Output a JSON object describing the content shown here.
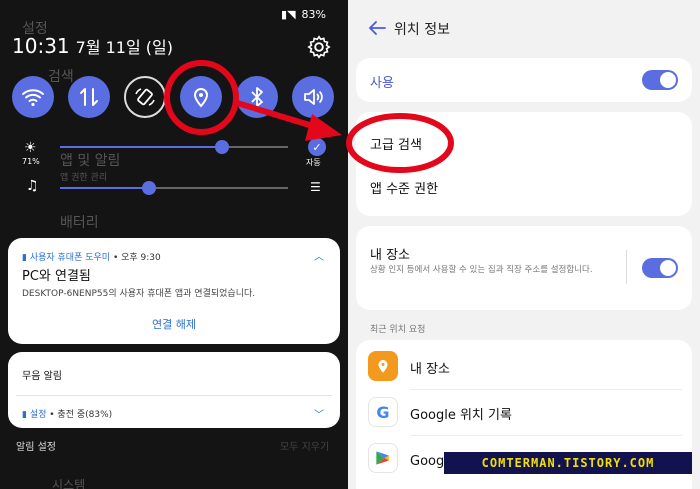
{
  "left_panel": {
    "statusbar": {
      "battery": "83%"
    },
    "ghost": {
      "settings": "설정",
      "search": "검색",
      "app_alarm": "앱 및 알림",
      "app_alarm_sub": "앱 권한 관리",
      "battery": "배터리",
      "system": "시스템"
    },
    "clock": {
      "time": "10:31",
      "date": "7월 11일 (일)"
    },
    "quick_settings": [
      "wifi",
      "mobile-data",
      "auto-rotate",
      "location",
      "bluetooth",
      "sound"
    ],
    "brightness": {
      "value_label": "71%",
      "auto_label": "자동",
      "level": 0.71
    },
    "volume": {
      "level": 0.39
    },
    "notification": {
      "app": "사용자 휴대폰 도우미",
      "time": " • 오후 9:30",
      "title": "PC와 연결됨",
      "body": "DESKTOP-6NENP55의 사용자 휴대폰 앱과 연결되었습니다.",
      "action": "연결 해제"
    },
    "silent": {
      "header": "무음 알림",
      "app": "설정",
      "text": " • 충전 중(83%)"
    },
    "footer": {
      "settings": "알림 설정",
      "clear": "모두 지우기"
    }
  },
  "right_panel": {
    "header": {
      "title": "위치 정보"
    },
    "use": {
      "label": "사용",
      "enabled": true
    },
    "menu": {
      "advanced": "고급 검색",
      "app_perm": "앱 수준 권한"
    },
    "my_place": {
      "title": "내 장소",
      "subtitle": "상황 인지 등에서 사용할 수 있는 집과 직장 주소를 설정합니다.",
      "enabled": true
    },
    "recent_label": "최근 위치 요청",
    "recent": [
      {
        "label": "내 장소",
        "icon": "location-pin-icon"
      },
      {
        "label": "Google 위치 기록",
        "icon": "google-icon"
      },
      {
        "label": "Google Play 서비스",
        "icon": "play-services-icon"
      }
    ]
  },
  "watermark": "COMTERMAN.TISTORY.COM",
  "colors": {
    "accent": "#5b6ee1",
    "highlight": "#e3071c"
  }
}
